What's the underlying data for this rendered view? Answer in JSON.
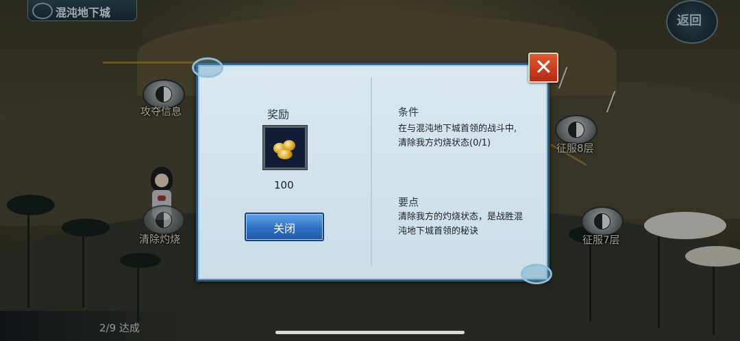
{
  "header": {
    "title": "混沌地下城",
    "back_label": "返回"
  },
  "map": {
    "nodes": [
      {
        "label": "攻夺信息"
      },
      {
        "label": "清除灼烧"
      },
      {
        "label": "征服8层"
      },
      {
        "label": "征服7层"
      }
    ],
    "progress_text": "2/9 达成"
  },
  "dialog": {
    "reward_title": "奖励",
    "reward_item_icon": "gold-ingot-icon",
    "reward_amount": "100",
    "close_button_label": "关闭",
    "condition_title": "条件",
    "condition_lines": [
      "在与混沌地下城首领的战斗中,",
      "清除我方灼烧状态(0/1)"
    ],
    "tip_title": "要点",
    "tip_lines": [
      "清除我方的灼烧状态，是战胜混",
      "沌地下城首领的秘诀"
    ],
    "colors": {
      "panel": "#d9e8f0",
      "border": "#2c5b82",
      "button": "#2e6fc4",
      "close": "#d2462a"
    }
  }
}
